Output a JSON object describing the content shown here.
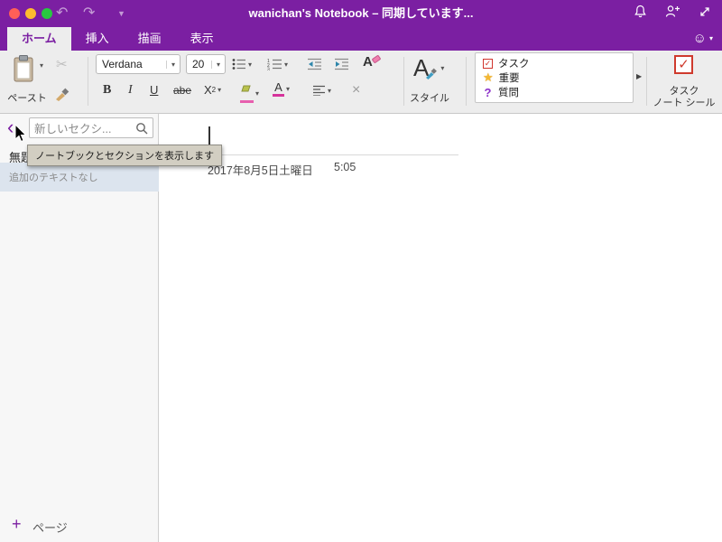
{
  "titlebar": {
    "title": "wanichan's Notebook – 同期しています..."
  },
  "tabs": {
    "items": [
      {
        "label": "ホーム"
      },
      {
        "label": "挿入"
      },
      {
        "label": "描画"
      },
      {
        "label": "表示"
      }
    ]
  },
  "ribbon": {
    "paste_label": "ペースト",
    "font_family": "Verdana",
    "font_size": "20",
    "style_label": "スタイル",
    "tags": {
      "items": [
        {
          "label": "タスク"
        },
        {
          "label": "重要"
        },
        {
          "label": "質問"
        }
      ]
    },
    "task_seal": {
      "line1": "タスク",
      "line2": "ノート シール"
    }
  },
  "sidebar": {
    "search_value": "新しいセクシ...",
    "tooltip": "ノートブックとセクションを表示します",
    "page": {
      "title": "無題...",
      "subtitle": "追加のテキストなし"
    },
    "add_page_label": "ページ"
  },
  "content": {
    "date": "2017年8月5日土曜日",
    "time": "5:05"
  },
  "icons": {
    "undo": "↶",
    "redo": "↷",
    "titlebar_chevron": "▼",
    "smiley": "☺",
    "dropdown": "▾",
    "scissors": "✂",
    "bold": "B",
    "italic": "I",
    "underline": "U",
    "strike": "abe",
    "subscript_base": "X",
    "subscript_sub": "2",
    "letter_a": "A",
    "delete_x": "×",
    "check": "✓",
    "star": "★",
    "question": "?",
    "tags_expand": "▶",
    "back_chevron": "‹",
    "plus": "+"
  }
}
